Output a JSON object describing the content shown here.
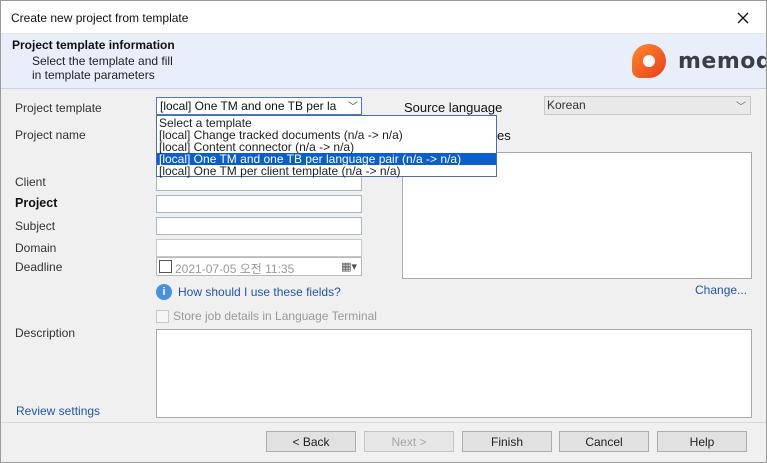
{
  "window": {
    "title": "Create new project from template"
  },
  "header": {
    "title": "Project template information",
    "subtitle_line1": "Select the template and fill",
    "subtitle_line2": "in template parameters",
    "logo_text": "memoq"
  },
  "form": {
    "project_template_label": "Project template",
    "project_template_value": "[local] One TM and one TB per la",
    "project_name_label": "Project name",
    "client_label": "Client",
    "project_label": "Project",
    "subject_label": "Subject",
    "domain_label": "Domain",
    "deadline_label": "Deadline",
    "deadline_value": "2021-07-05 오전 11:35",
    "description_label": "Description",
    "source_language_label": "Source language",
    "source_language_value": "Korean",
    "target_languages_label_visible": "es",
    "help_link": "How should I use these fields?",
    "change_link": "Change...",
    "store_job_details": "Store job details in Language Terminal",
    "review_settings": "Review settings"
  },
  "template_dropdown": {
    "options": [
      "Select a template",
      "[local]  Change tracked documents (n/a -> n/a)",
      "[local]  Content connector (n/a -> n/a)",
      "[local]  One TM and one TB per language pair (n/a -> n/a)",
      "[local]  One TM per client template (n/a -> n/a)"
    ],
    "selected_index": 3
  },
  "buttons": {
    "back": "< Back",
    "next": "Next >",
    "finish": "Finish",
    "cancel": "Cancel",
    "help": "Help"
  }
}
